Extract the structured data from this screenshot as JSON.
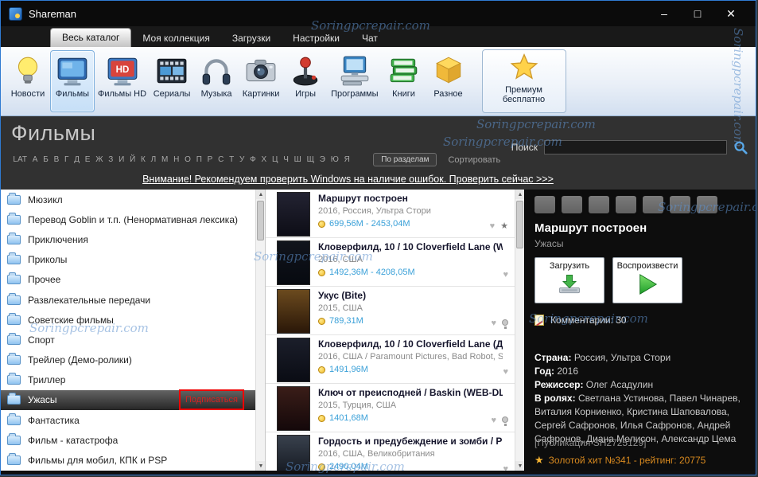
{
  "window": {
    "title": "Shareman",
    "controls": {
      "minimize": "–",
      "maximize": "□",
      "close": "✕"
    }
  },
  "tabs": [
    {
      "name": "tab-all-catalog",
      "label": "Весь каталог",
      "active": true
    },
    {
      "name": "tab-my-collection",
      "label": "Моя коллекция"
    },
    {
      "name": "tab-downloads",
      "label": "Загрузки"
    },
    {
      "name": "tab-settings",
      "label": "Настройки"
    },
    {
      "name": "tab-chat",
      "label": "Чат"
    }
  ],
  "toolbar": {
    "items": [
      {
        "name": "toolbar-item-news",
        "label": "Новости",
        "icon": "lightbulb-icon"
      },
      {
        "name": "toolbar-item-movies",
        "label": "Фильмы",
        "icon": "monitor-icon",
        "selected": true
      },
      {
        "name": "toolbar-item-movies-hd",
        "label": "Фильмы HD",
        "icon": "hd-monitor-icon"
      },
      {
        "name": "toolbar-item-series",
        "label": "Сериалы",
        "icon": "filmstrip-icon"
      },
      {
        "name": "toolbar-item-music",
        "label": "Музыка",
        "icon": "headphones-icon"
      },
      {
        "name": "toolbar-item-pictures",
        "label": "Картинки",
        "icon": "camera-icon"
      },
      {
        "name": "toolbar-item-games",
        "label": "Игры",
        "icon": "joystick-icon"
      },
      {
        "name": "toolbar-item-programs",
        "label": "Программы",
        "icon": "computer-icon"
      },
      {
        "name": "toolbar-item-books",
        "label": "Книги",
        "icon": "books-icon"
      },
      {
        "name": "toolbar-item-misc",
        "label": "Разное",
        "icon": "box-icon"
      }
    ],
    "premium": {
      "label": "Премиум бесплатно",
      "icon": "star-icon"
    }
  },
  "header": {
    "title": "Фильмы",
    "alphabet": [
      "LAT",
      "А",
      "Б",
      "В",
      "Г",
      "Д",
      "Е",
      "Ж",
      "З",
      "И",
      "Й",
      "К",
      "Л",
      "М",
      "Н",
      "О",
      "П",
      "Р",
      "С",
      "Т",
      "У",
      "Ф",
      "Х",
      "Ц",
      "Ч",
      "Ш",
      "Щ",
      "Э",
      "Ю",
      "Я"
    ],
    "by_sections_label": "По разделам",
    "sort_label": "Сортировать",
    "search_label": "Поиск"
  },
  "notice": {
    "text": "Внимание! Рекомендуем проверить Windows на наличие ошибок. Проверить сейчас >>>"
  },
  "sidebar": {
    "items": [
      {
        "label": "Мюзикл"
      },
      {
        "label": "Перевод Goblin и т.п. (Ненормативная лексика)"
      },
      {
        "label": "Приключения"
      },
      {
        "label": "Приколы"
      },
      {
        "label": "Прочее"
      },
      {
        "label": "Развлекательные передачи"
      },
      {
        "label": "Советские фильмы"
      },
      {
        "label": "Спорт"
      },
      {
        "label": "Трейлер (Демо-ролики)"
      },
      {
        "label": "Триллер"
      },
      {
        "label": "Ужасы",
        "selected": true,
        "action": "Подписаться"
      },
      {
        "label": "Фантастика"
      },
      {
        "label": "Фильм - катастрофа"
      },
      {
        "label": "Фильмы для мобил, КПК и PSP"
      }
    ]
  },
  "movies": [
    {
      "title": "Маршрут построен",
      "subtitle": "2016, Россия, Ультра Стори",
      "size": "699,56M - 2453,04M",
      "poster": [
        "#232332",
        "#0d0d16"
      ],
      "icons": [
        "heart",
        "star"
      ]
    },
    {
      "title": "Кловерфилд, 10  / 10 Cloverfield Lane (W",
      "subtitle": "2016, США",
      "size": "1492,36M - 4208,05M",
      "poster": [
        "#11141c",
        "#070a10"
      ],
      "icons": [
        "heart"
      ]
    },
    {
      "title": "Укус (Bite)",
      "subtitle": "2015, США",
      "size": "789,31M",
      "poster": [
        "#6b4a1e",
        "#2a1708"
      ],
      "icons": [
        "heart",
        "bulb"
      ]
    },
    {
      "title": "Кловерфилд, 10 / 10 Cloverfield Lane (Д",
      "subtitle": "2016, США / Paramount Pictures, Bad Robot, Sp",
      "size": "1491,96M",
      "poster": [
        "#1b1e2a",
        "#0a0c14"
      ],
      "icons": [
        "heart"
      ]
    },
    {
      "title": "Ключ от преисподней / Baskin (WEB-DL",
      "subtitle": "2015, Турция, США",
      "size": "1401,68M",
      "poster": [
        "#3a1d18",
        "#14080a"
      ],
      "icons": [
        "heart",
        "bulb"
      ]
    },
    {
      "title": "Гордость и предубеждение и зомби / P",
      "subtitle": "2016, США, Великобритания",
      "size": "2490,04M",
      "poster": [
        "#39414d",
        "#10141c"
      ],
      "icons": [
        "heart"
      ]
    }
  ],
  "details": {
    "action_icons": [
      "upload-icon",
      "note-icon",
      "copy-icon",
      "folder-open-icon",
      "folder-icon",
      "pencil-icon",
      "magic-wand-icon"
    ],
    "title": "Маршрут построен",
    "category": "Ужасы",
    "download_label": "Загрузить",
    "play_label": "Воспроизвести",
    "comments_label": "Комментарии: 30",
    "fields": [
      {
        "label": "Страна:",
        "value": "Россия, Ультра Стори"
      },
      {
        "label": "Год:",
        "value": "2016"
      },
      {
        "label": "Режиссер:",
        "value": "Олег Асадулин"
      },
      {
        "label": "В ролях:",
        "value": "Светлана Устинова, Павел Чинарев, Виталия Корниенко, Кристина Шаповалова, Сергей Сафронов, Илья Сафронов, Андрей Сафронов, Диана Мелисон, Александр Цема"
      }
    ],
    "publication": "[Публикация SH2725129]",
    "golden_hit": "Золотой хит №341 - рейтинг: 20775"
  },
  "watermark": "Soringpcrepair.com"
}
